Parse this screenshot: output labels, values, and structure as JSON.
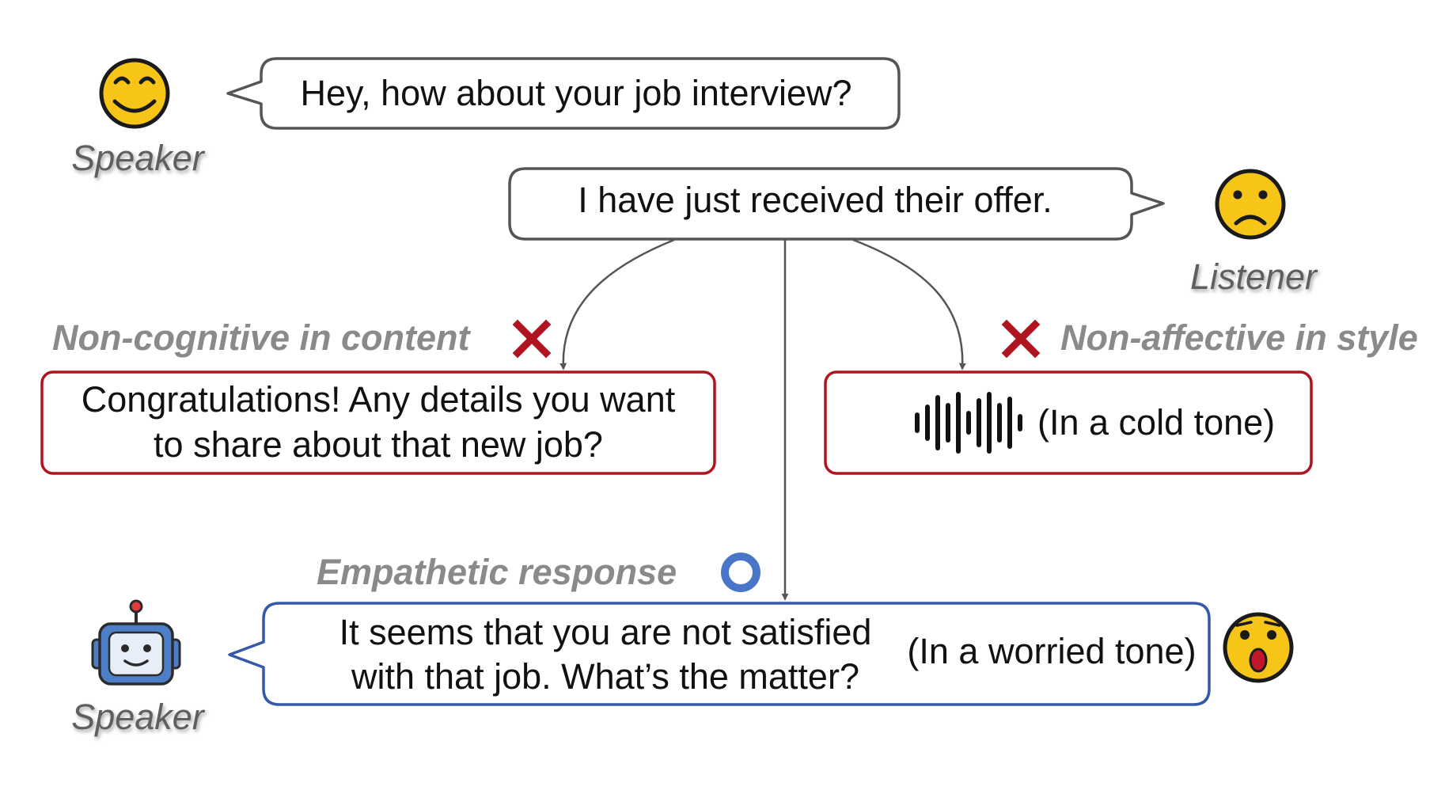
{
  "figure": {
    "speaker_top": {
      "label": "Speaker",
      "utterance": "Hey, how about your job interview?"
    },
    "listener": {
      "label": "Listener",
      "utterance": "I have just received their offer."
    },
    "non_cognitive": {
      "label": "Non-cognitive in content",
      "response_line1": "Congratulations! Any details you want",
      "response_line2": "to share about that new job?"
    },
    "non_affective": {
      "label": "Non-affective in style",
      "tone": "(In a cold tone)"
    },
    "empathetic": {
      "label": "Empathetic response",
      "response_line1": "It seems that you are not satisfied",
      "response_line2": "with that job. What’s the matter?",
      "tone": "(In a worried tone)"
    },
    "speaker_bottom": {
      "label": "Speaker"
    },
    "colors": {
      "neutral_border": "#555555",
      "wrong_border": "#b0141e",
      "correct_border": "#3559a8",
      "cross": "#b0141e",
      "circle": "#4a76c9",
      "emoji_fill": "#f6c517"
    },
    "icons": [
      "smiling-face-icon",
      "frowning-face-icon",
      "cross-icon",
      "sound-wave-icon",
      "circle-icon",
      "robot-icon",
      "surprised-face-icon"
    ]
  }
}
